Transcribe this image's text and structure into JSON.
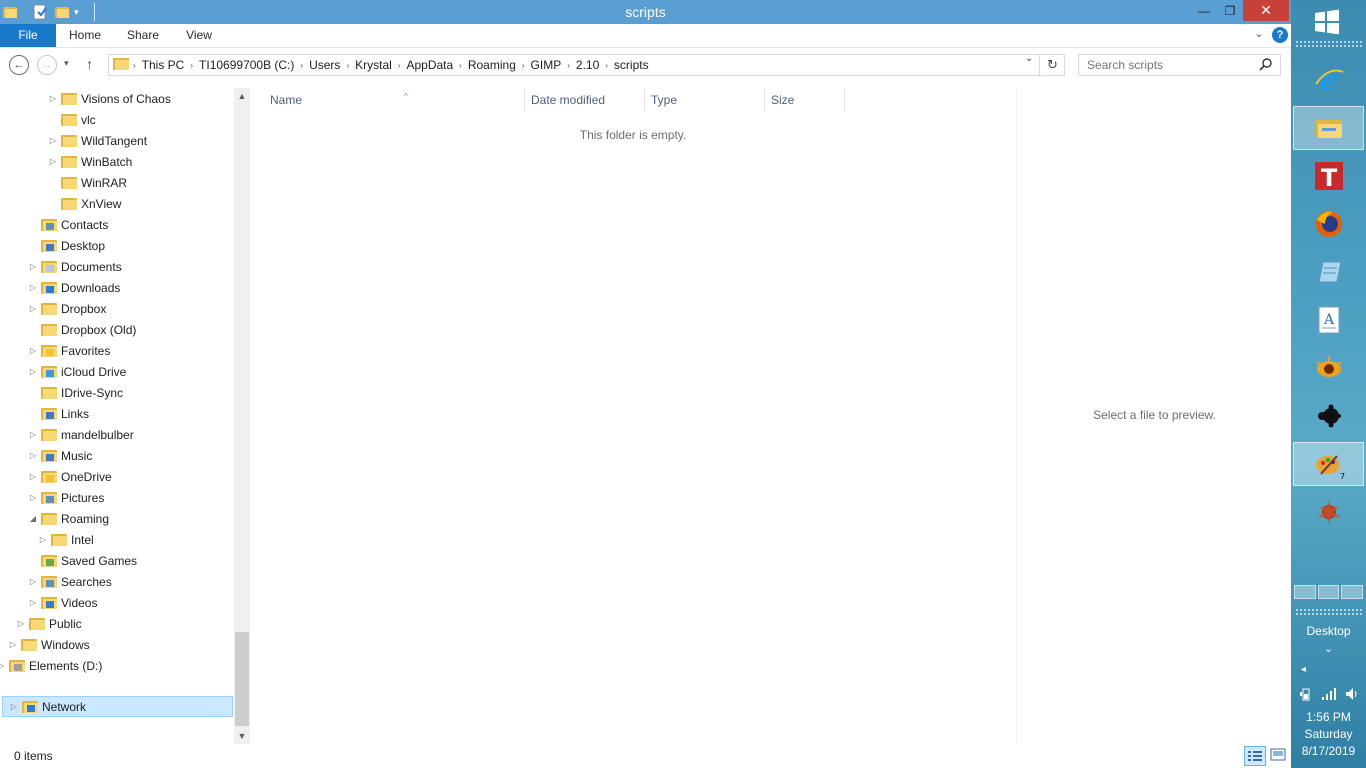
{
  "window": {
    "title": "scripts",
    "caption_minimize": "—",
    "caption_maximize": "❐",
    "caption_close": "✕"
  },
  "ribbon": {
    "tabs": [
      "File",
      "Home",
      "Share",
      "View"
    ],
    "help": "?"
  },
  "address": {
    "crumbs": [
      "This PC",
      "TI10699700B (C:)",
      "Users",
      "Krystal",
      "AppData",
      "Roaming",
      "GIMP",
      "2.10",
      "scripts"
    ],
    "search_placeholder": "Search scripts"
  },
  "tree": {
    "items": [
      {
        "label": "Visions of Chaos",
        "expandable": true
      },
      {
        "label": "vlc",
        "expandable": false
      },
      {
        "label": "WildTangent",
        "expandable": true
      },
      {
        "label": "WinBatch",
        "expandable": true
      },
      {
        "label": "WinRAR",
        "expandable": false
      },
      {
        "label": "XnView",
        "expandable": false
      },
      {
        "label": "Contacts",
        "expandable": false
      },
      {
        "label": "Desktop",
        "expandable": false
      },
      {
        "label": "Documents",
        "expandable": true
      },
      {
        "label": "Downloads",
        "expandable": true
      },
      {
        "label": "Dropbox",
        "expandable": true
      },
      {
        "label": "Dropbox (Old)",
        "expandable": false
      },
      {
        "label": "Favorites",
        "expandable": true
      },
      {
        "label": "iCloud Drive",
        "expandable": true
      },
      {
        "label": "IDrive-Sync",
        "expandable": false
      },
      {
        "label": "Links",
        "expandable": false
      },
      {
        "label": "mandelbulber",
        "expandable": true
      },
      {
        "label": "Music",
        "expandable": true
      },
      {
        "label": "OneDrive",
        "expandable": true
      },
      {
        "label": "Pictures",
        "expandable": true
      },
      {
        "label": "Roaming",
        "expandable": true,
        "expanded": true
      },
      {
        "label": "Intel",
        "expandable": true
      },
      {
        "label": "Saved Games",
        "expandable": false
      },
      {
        "label": "Searches",
        "expandable": true
      },
      {
        "label": "Videos",
        "expandable": true
      },
      {
        "label": "Public",
        "expandable": true
      },
      {
        "label": "Windows",
        "expandable": true
      },
      {
        "label": "Elements (D:)",
        "expandable": true
      },
      {
        "label": "Network",
        "expandable": true,
        "selected": true
      }
    ]
  },
  "columns": [
    "Name",
    "Date modified",
    "Type",
    "Size"
  ],
  "content": {
    "empty_message": "This folder is empty."
  },
  "preview": {
    "message": "Select a file to preview."
  },
  "status": {
    "items": "0 items"
  },
  "taskbar": {
    "desktop_label": "Desktop",
    "badge": "7",
    "time": "1:56 PM",
    "day": "Saturday",
    "date": "8/17/2019"
  },
  "colors": {
    "titlebar": "#5a9fd3",
    "file_tab": "#1979ca",
    "close": "#c7403a",
    "selection": "#cce8ff"
  }
}
